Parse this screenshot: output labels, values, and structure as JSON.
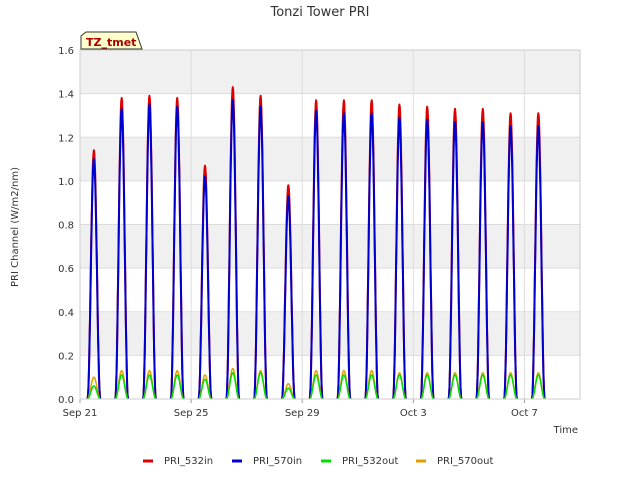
{
  "chart_data": {
    "type": "line",
    "title": "Tonzi Tower PRI",
    "xlabel": "Time",
    "ylabel": "PRI Channel (W/m2/nm)",
    "badge": "TZ_tmet",
    "xlim": [
      "2023-09-21",
      "2023-10-09"
    ],
    "ylim": [
      0,
      1.6
    ],
    "yticks": [
      0.0,
      0.2,
      0.4,
      0.6,
      0.8,
      1.0,
      1.2,
      1.4,
      1.6
    ],
    "xticks": [
      {
        "date": "2023-09-21",
        "label": "Sep 21"
      },
      {
        "date": "2023-09-25",
        "label": "Sep 25"
      },
      {
        "date": "2023-09-29",
        "label": "Sep 29"
      },
      {
        "date": "2023-10-03",
        "label": "Oct 3"
      },
      {
        "date": "2023-10-07",
        "label": "Oct 7"
      }
    ],
    "grid": true,
    "legend_position": "bottom",
    "days": [
      "2023-09-21",
      "2023-09-22",
      "2023-09-23",
      "2023-09-24",
      "2023-09-25",
      "2023-09-26",
      "2023-09-27",
      "2023-09-28",
      "2023-09-29",
      "2023-09-30",
      "2023-10-01",
      "2023-10-02",
      "2023-10-03",
      "2023-10-04",
      "2023-10-05",
      "2023-10-06",
      "2023-10-07",
      "2023-10-08"
    ],
    "series": [
      {
        "name": "PRI_532in",
        "color": "#dd0000",
        "daily_peak": [
          1.14,
          1.38,
          1.39,
          1.38,
          1.07,
          1.43,
          1.39,
          0.98,
          1.37,
          1.37,
          1.37,
          1.35,
          1.34,
          1.33,
          1.33,
          1.31,
          1.31,
          0
        ]
      },
      {
        "name": "PRI_570in",
        "color": "#0000cc",
        "daily_peak": [
          1.1,
          1.33,
          1.35,
          1.34,
          1.02,
          1.37,
          1.34,
          0.93,
          1.32,
          1.31,
          1.31,
          1.29,
          1.28,
          1.27,
          1.27,
          1.25,
          1.25,
          0
        ]
      },
      {
        "name": "PRI_532out",
        "color": "#00dd00",
        "daily_peak": [
          0.06,
          0.11,
          0.11,
          0.11,
          0.09,
          0.12,
          0.12,
          0.05,
          0.11,
          0.11,
          0.11,
          0.11,
          0.11,
          0.11,
          0.11,
          0.11,
          0.11,
          0
        ]
      },
      {
        "name": "PRI_570out",
        "color": "#e0a000",
        "daily_peak": [
          0.1,
          0.13,
          0.13,
          0.13,
          0.11,
          0.14,
          0.13,
          0.07,
          0.13,
          0.13,
          0.13,
          0.12,
          0.12,
          0.12,
          0.12,
          0.12,
          0.12,
          0
        ]
      }
    ]
  }
}
